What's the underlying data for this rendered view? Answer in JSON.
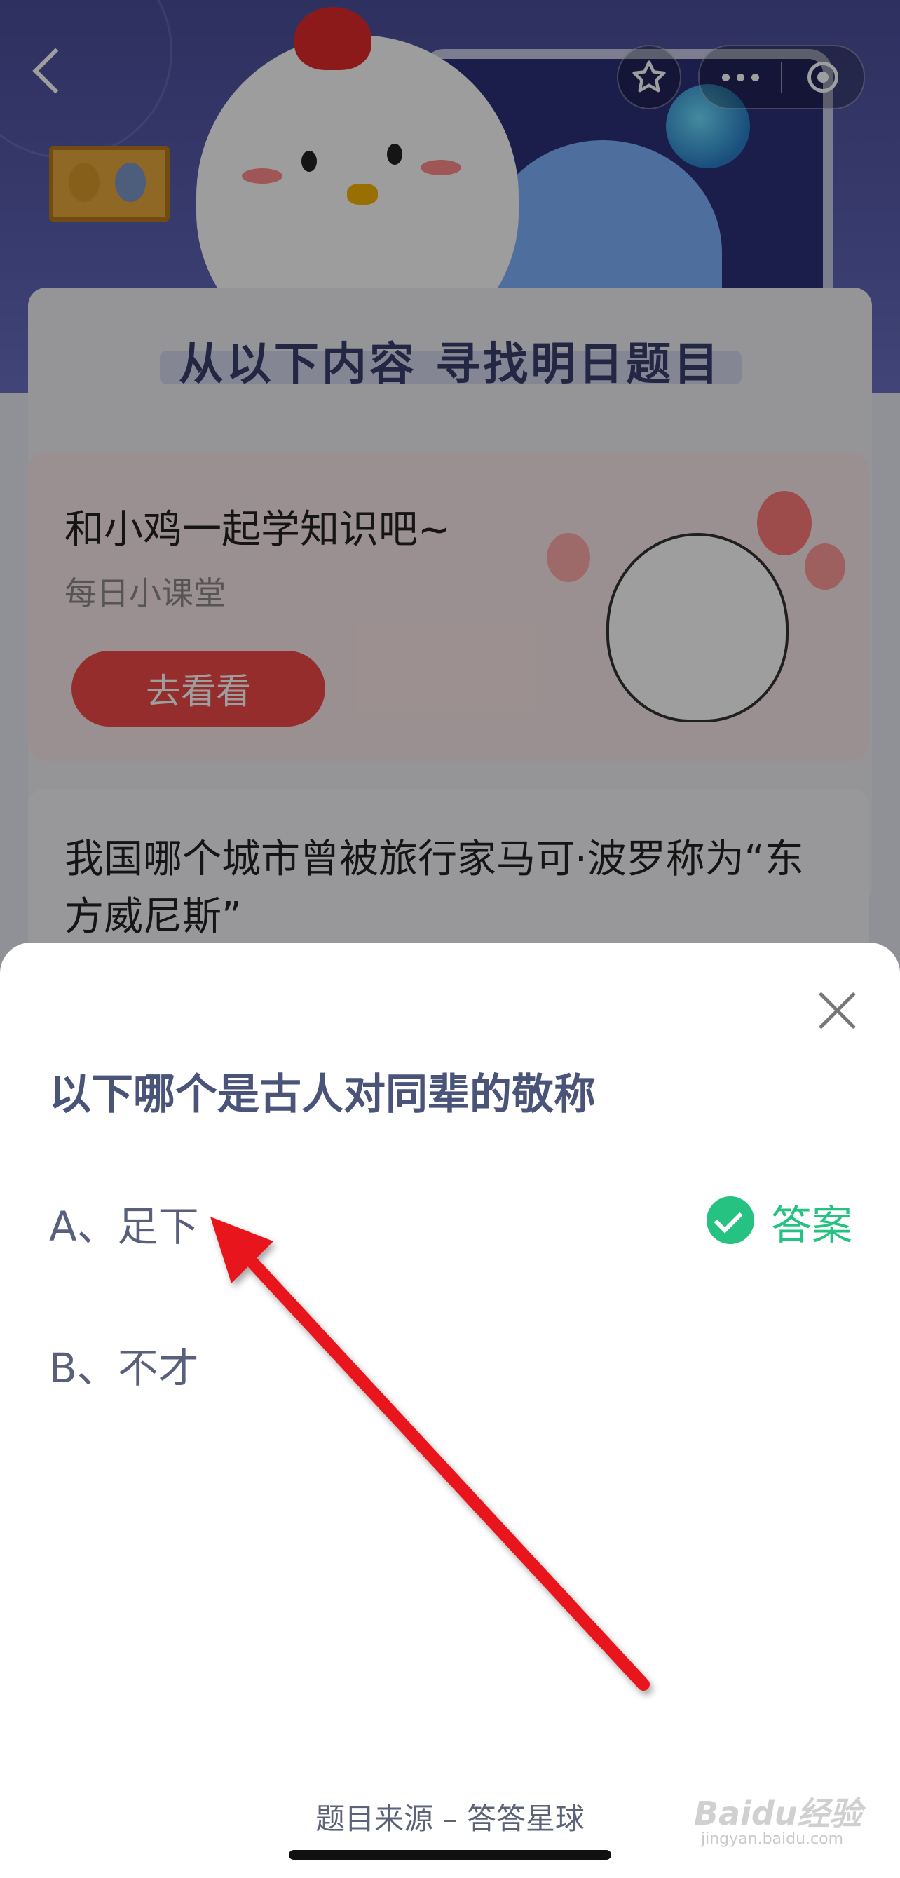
{
  "background_page": {
    "section_title": "从以下内容 寻找明日题目",
    "promo": {
      "title": "和小鸡一起学知识吧~",
      "subtitle": "每日小课堂",
      "button_label": "去看看"
    },
    "question_preview": "我国哪个城市曾被旅行家马可·波罗称为“东方威尼斯”"
  },
  "nav": {
    "back_icon": "chevron-left-icon",
    "favorite_icon": "star-icon",
    "more_icon": "more-dots-icon",
    "miniapp_icon": "target-icon"
  },
  "sheet": {
    "question": "以下哪个是古人对同辈的敬称",
    "options": [
      {
        "label": "A、足下",
        "is_answer": true
      },
      {
        "label": "B、不才",
        "is_answer": false
      }
    ],
    "answer_label": "答案",
    "source": "题目来源 – 答答星球"
  },
  "watermark": {
    "brand": "Baidu经验",
    "url": "jingyan.baidu.com"
  },
  "colors": {
    "answer_green": "#26c281",
    "arrow_red": "#e8151c",
    "question_text": "#4a5479"
  }
}
